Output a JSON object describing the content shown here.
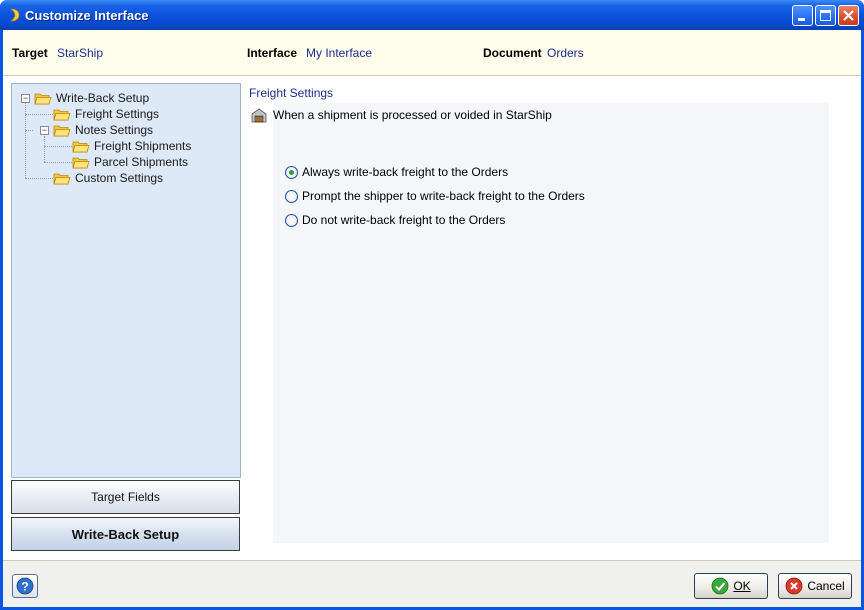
{
  "window": {
    "title": "Customize Interface",
    "buttons": {
      "minimize": "minimize-icon",
      "maximize": "maximize-icon",
      "close": "close-icon"
    }
  },
  "header": {
    "target_label": "Target",
    "target_value": "StarShip",
    "interface_label": "Interface",
    "interface_value": "My Interface",
    "document_label": "Document",
    "document_value": "Orders"
  },
  "tree": {
    "items": [
      {
        "label": "Write-Back Setup",
        "expanded": true
      },
      {
        "label": "Freight Settings",
        "selected": true
      },
      {
        "label": "Notes Settings",
        "expanded": true
      },
      {
        "label": "Freight Shipments"
      },
      {
        "label": "Parcel Shipments"
      },
      {
        "label": "Custom Settings"
      }
    ]
  },
  "nav": {
    "target_fields": "Target Fields",
    "write_back_setup": "Write-Back Setup"
  },
  "panel": {
    "title": "Freight Settings",
    "question": "When a shipment is processed or voided in StarShip",
    "options": [
      {
        "label": "Always write-back freight to the Orders",
        "checked": true
      },
      {
        "label": "Prompt the shipper to write-back freight to the Orders",
        "checked": false
      },
      {
        "label": "Do not write-back freight to the Orders",
        "checked": false
      }
    ]
  },
  "footer": {
    "ok_label": "OK",
    "cancel_label": "Cancel"
  },
  "colors": {
    "titlebar": "#0a52dd",
    "header_bg": "#fffdec",
    "value_text": "#1a2e8c",
    "tree_bg": "#dde9f7"
  }
}
